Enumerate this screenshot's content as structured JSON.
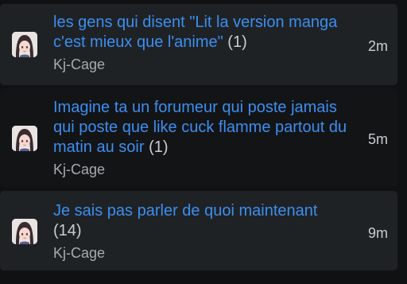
{
  "topics": [
    {
      "title": "les gens qui disent \"Lit la version manga c'est mieux que l'anime\"",
      "count": "(1)",
      "author": "Kj-Cage",
      "time": "2m"
    },
    {
      "title": "Imagine ta un forumeur qui poste jamais qui poste que like cuck flamme partout du matin au soir",
      "count": "(1)",
      "author": "Kj-Cage",
      "time": "5m"
    },
    {
      "title": "Je sais pas parler de quoi maintenant",
      "count": "(14)",
      "author": "Kj-Cage",
      "time": "9m"
    }
  ],
  "colors": {
    "link": "#3b8ef0",
    "row_alt_bg": "#1f2225",
    "row_bg": "#131416",
    "page_bg": "#101112"
  },
  "icons": {
    "avatar": "user-avatar-icon"
  }
}
